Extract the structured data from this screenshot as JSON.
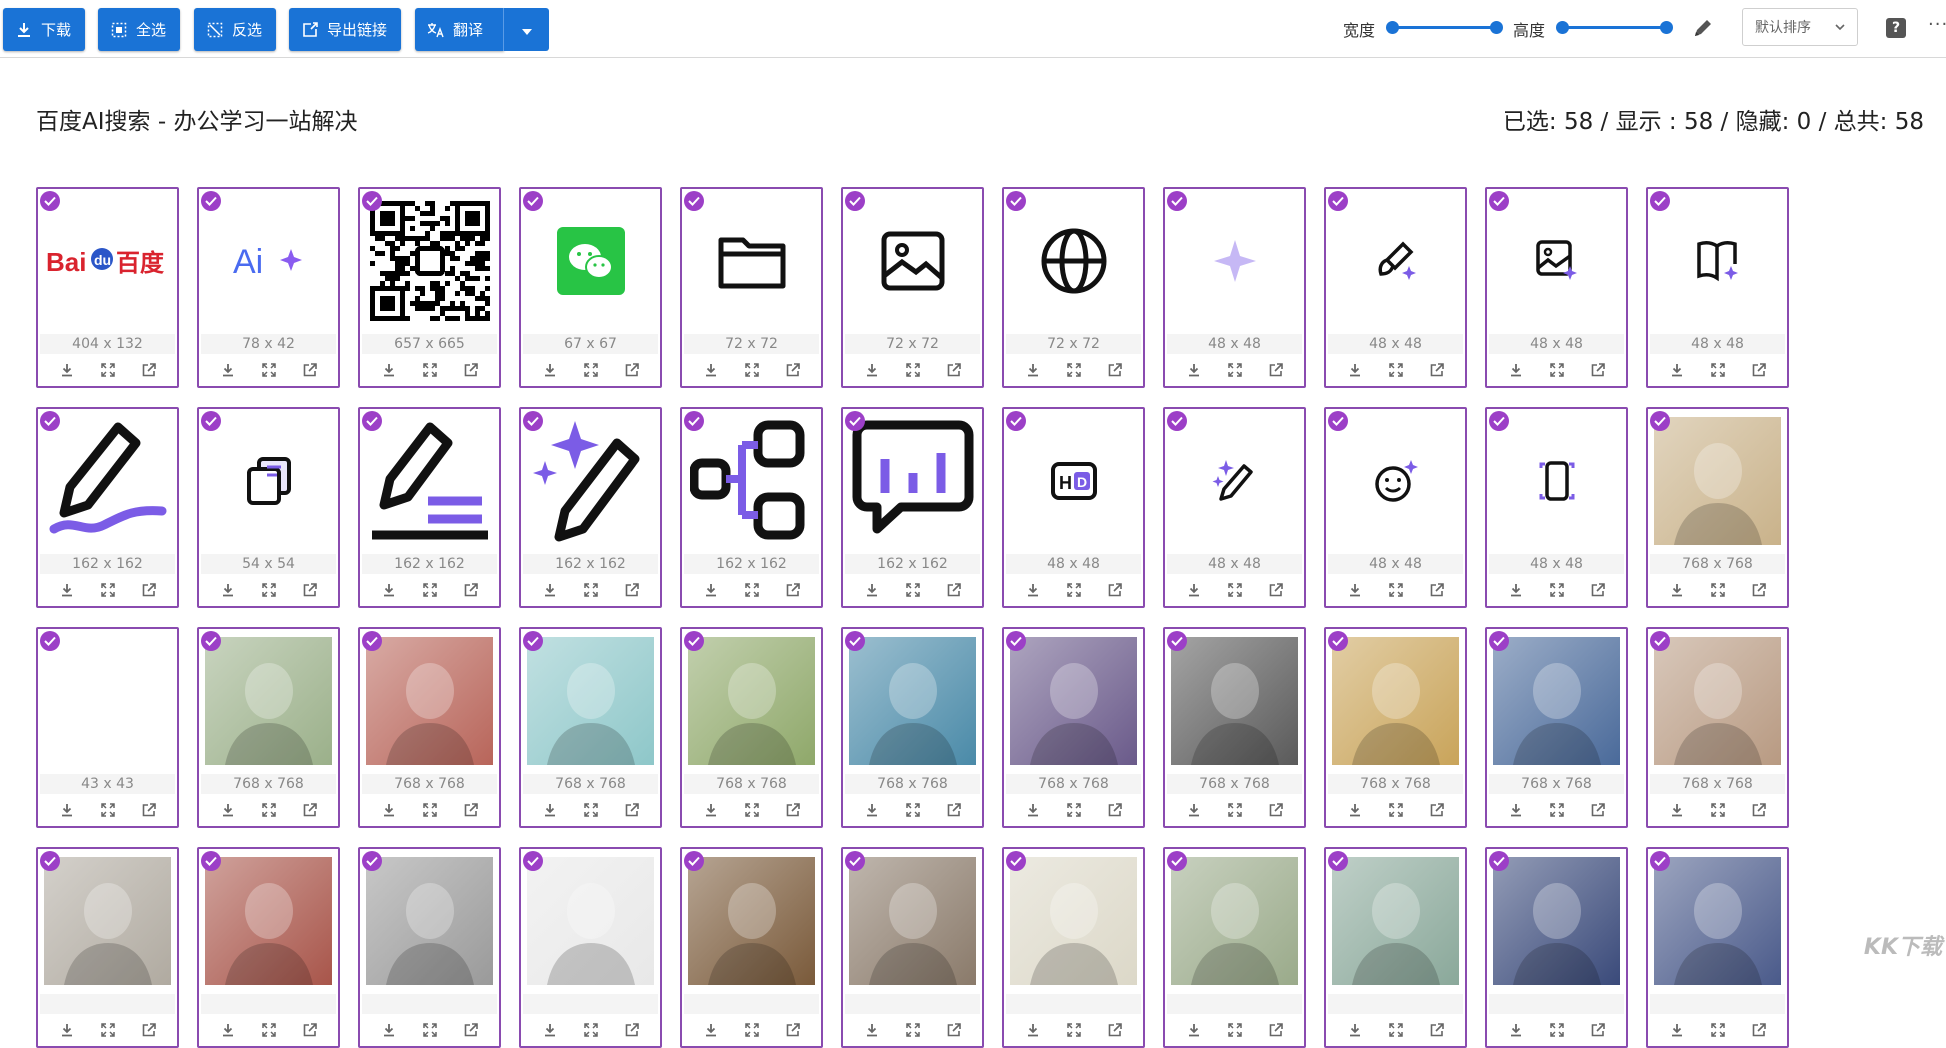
{
  "toolbar": {
    "buttons": [
      {
        "label": "下载",
        "icon": "download-icon"
      },
      {
        "label": "全选",
        "icon": "select-all-icon"
      },
      {
        "label": "反选",
        "icon": "invert-selection-icon"
      },
      {
        "label": "导出链接",
        "icon": "export-link-icon"
      },
      {
        "label": "翻译",
        "icon": "translate-icon"
      }
    ],
    "width_label": "宽度",
    "height_label": "高度",
    "width_level": 1.0,
    "height_level": 1.0,
    "sort_label": "默认排序",
    "help_label": "?",
    "more_label": "···"
  },
  "header": {
    "title": "百度AI搜索 - 办公学习一站解决",
    "stats": "已选: 58 / 显示 : 58 / 隐藏: 0 / 总共: 58"
  },
  "colors": {
    "accent": "#1a73d6",
    "selected_border": "#8a4bb0",
    "check": "#9c3fc7",
    "purple_icon": "#7b5ce6"
  },
  "cards": [
    {
      "size": "404 x 132",
      "thumb": "baidu-logo"
    },
    {
      "size": "78 x 42",
      "thumb": "ai-logo"
    },
    {
      "size": "657 x 665",
      "thumb": "qr-code"
    },
    {
      "size": "67 x 67",
      "thumb": "wechat-logo"
    },
    {
      "size": "72 x 72",
      "thumb": "folder-icon"
    },
    {
      "size": "72 x 72",
      "thumb": "image-icon"
    },
    {
      "size": "72 x 72",
      "thumb": "globe-icon"
    },
    {
      "size": "48 x 48",
      "thumb": "sparkle-icon"
    },
    {
      "size": "48 x 48",
      "thumb": "brush-sparkle-icon"
    },
    {
      "size": "48 x 48",
      "thumb": "image-sparkle-icon"
    },
    {
      "size": "48 x 48",
      "thumb": "book-sparkle-icon"
    },
    {
      "size": "162 x 162",
      "thumb": "pen-wave-icon"
    },
    {
      "size": "54 x 54",
      "thumb": "documents-icon"
    },
    {
      "size": "162 x 162",
      "thumb": "pen-lines-icon"
    },
    {
      "size": "162 x 162",
      "thumb": "pen-sparkle-icon"
    },
    {
      "size": "162 x 162",
      "thumb": "mindmap-icon"
    },
    {
      "size": "162 x 162",
      "thumb": "chat-chart-icon"
    },
    {
      "size": "48 x 48",
      "thumb": "hd-icon"
    },
    {
      "size": "48 x 48",
      "thumb": "small-pen-sparkle-icon"
    },
    {
      "size": "48 x 48",
      "thumb": "smiley-sparkle-icon"
    },
    {
      "size": "48 x 48",
      "thumb": "phone-frame-icon"
    },
    {
      "size": "768 x 768",
      "thumb": "photo",
      "tone": "#c9b28a"
    },
    {
      "size": "43 x 43",
      "thumb": "blank"
    },
    {
      "size": "768 x 768",
      "thumb": "photo",
      "tone": "#9bb08a"
    },
    {
      "size": "768 x 768",
      "thumb": "photo",
      "tone": "#b8655a"
    },
    {
      "size": "768 x 768",
      "thumb": "photo",
      "tone": "#8ec7c9"
    },
    {
      "size": "768 x 768",
      "thumb": "photo",
      "tone": "#8fa86a"
    },
    {
      "size": "768 x 768",
      "thumb": "photo",
      "tone": "#4a8aa8"
    },
    {
      "size": "768 x 768",
      "thumb": "photo",
      "tone": "#6a5a8a"
    },
    {
      "size": "768 x 768",
      "thumb": "photo",
      "tone": "#5a5a5a"
    },
    {
      "size": "768 x 768",
      "thumb": "photo",
      "tone": "#c9a45a"
    },
    {
      "size": "768 x 768",
      "thumb": "photo",
      "tone": "#4a6a9a"
    },
    {
      "size": "768 x 768",
      "thumb": "photo",
      "tone": "#b89a82"
    },
    {
      "size": "",
      "thumb": "photo",
      "tone": "#b0aaa0"
    },
    {
      "size": "",
      "thumb": "photo",
      "tone": "#a8554a"
    },
    {
      "size": "",
      "thumb": "photo",
      "tone": "#9a9a9a"
    },
    {
      "size": "",
      "thumb": "photo",
      "tone": "#e8e8e8"
    },
    {
      "size": "",
      "thumb": "photo",
      "tone": "#7a5a3a"
    },
    {
      "size": "",
      "thumb": "photo",
      "tone": "#8a7a6a"
    },
    {
      "size": "",
      "thumb": "photo",
      "tone": "#dcd8c8"
    },
    {
      "size": "",
      "thumb": "photo",
      "tone": "#9aaa8a"
    },
    {
      "size": "",
      "thumb": "photo",
      "tone": "#8aa89a"
    },
    {
      "size": "",
      "thumb": "photo",
      "tone": "#3a4a7a"
    },
    {
      "size": "",
      "thumb": "photo",
      "tone": "#4a5a8a"
    }
  ],
  "watermark": "KK下载"
}
